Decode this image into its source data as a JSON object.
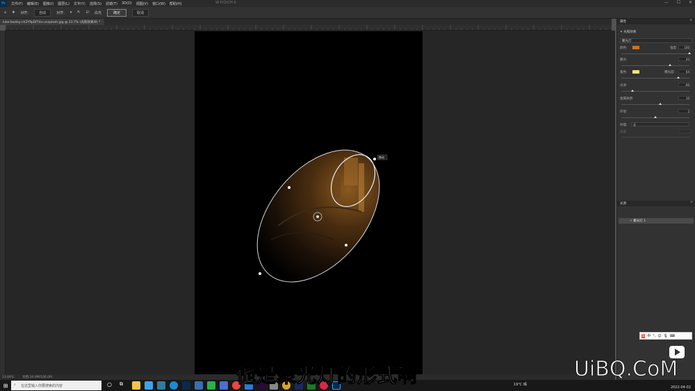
{
  "app": {
    "menu": [
      "文件(F)",
      "编辑(E)",
      "图像(I)",
      "图层(L)",
      "文字(Y)",
      "选择(S)",
      "滤镜(T)",
      "3D(D)",
      "视图(V)",
      "窗口(W)",
      "帮助(H)"
    ],
    "window_title": "W·P(Q)CH-S",
    "window_controls": [
      "—",
      "☐",
      "✕"
    ]
  },
  "options_bar": {
    "anchor_label": "对齐:",
    "anchor_value": "自动",
    "align_label": "对齐:",
    "checkbox_label": "白光",
    "confirm_label": "确定",
    "cancel_label": "取消"
  },
  "document": {
    "tab_title": "luke-besley-ch2Y9pDf74o-unsplash.jpg @ 23.7% (光照效果/8) *",
    "light_tag": "移动"
  },
  "status": {
    "zoom": "23.66%",
    "doc_size": "文档:34.9M/106.0M"
  },
  "properties": {
    "tab": "属性",
    "section_title": "光照效果",
    "light_type": "聚光灯",
    "color_label": "颜色:",
    "intensity_label": "强度:",
    "intensity_value": "100",
    "hotspot_label": "聚光:",
    "hotspot_value": "44",
    "coloring_label": "着色:",
    "exposure_label": "曝光度:",
    "exposure_value": "64",
    "gloss_label": "光泽:",
    "gloss_value": "-90",
    "metallic_label": "金属质感:",
    "metallic_value": "10",
    "ambience_label": "环境:",
    "ambience_value": "2",
    "texture_label": "纹理:",
    "texture_value": "无",
    "height_label": "高度:",
    "light_color": "#c8732a",
    "coloring_color": "#f3e27a"
  },
  "lights_panel": {
    "tab": "光源",
    "layer_name": "聚光灯 1"
  },
  "taskbar": {
    "search_placeholder": "在这里输入你要搜索的内容",
    "weather": "19°C 晴",
    "time": "",
    "date": "2022-04-02"
  },
  "overlay": {
    "subtitle": "他是聚光灯的形式啊",
    "watermark": "UiBQ.CoM"
  }
}
